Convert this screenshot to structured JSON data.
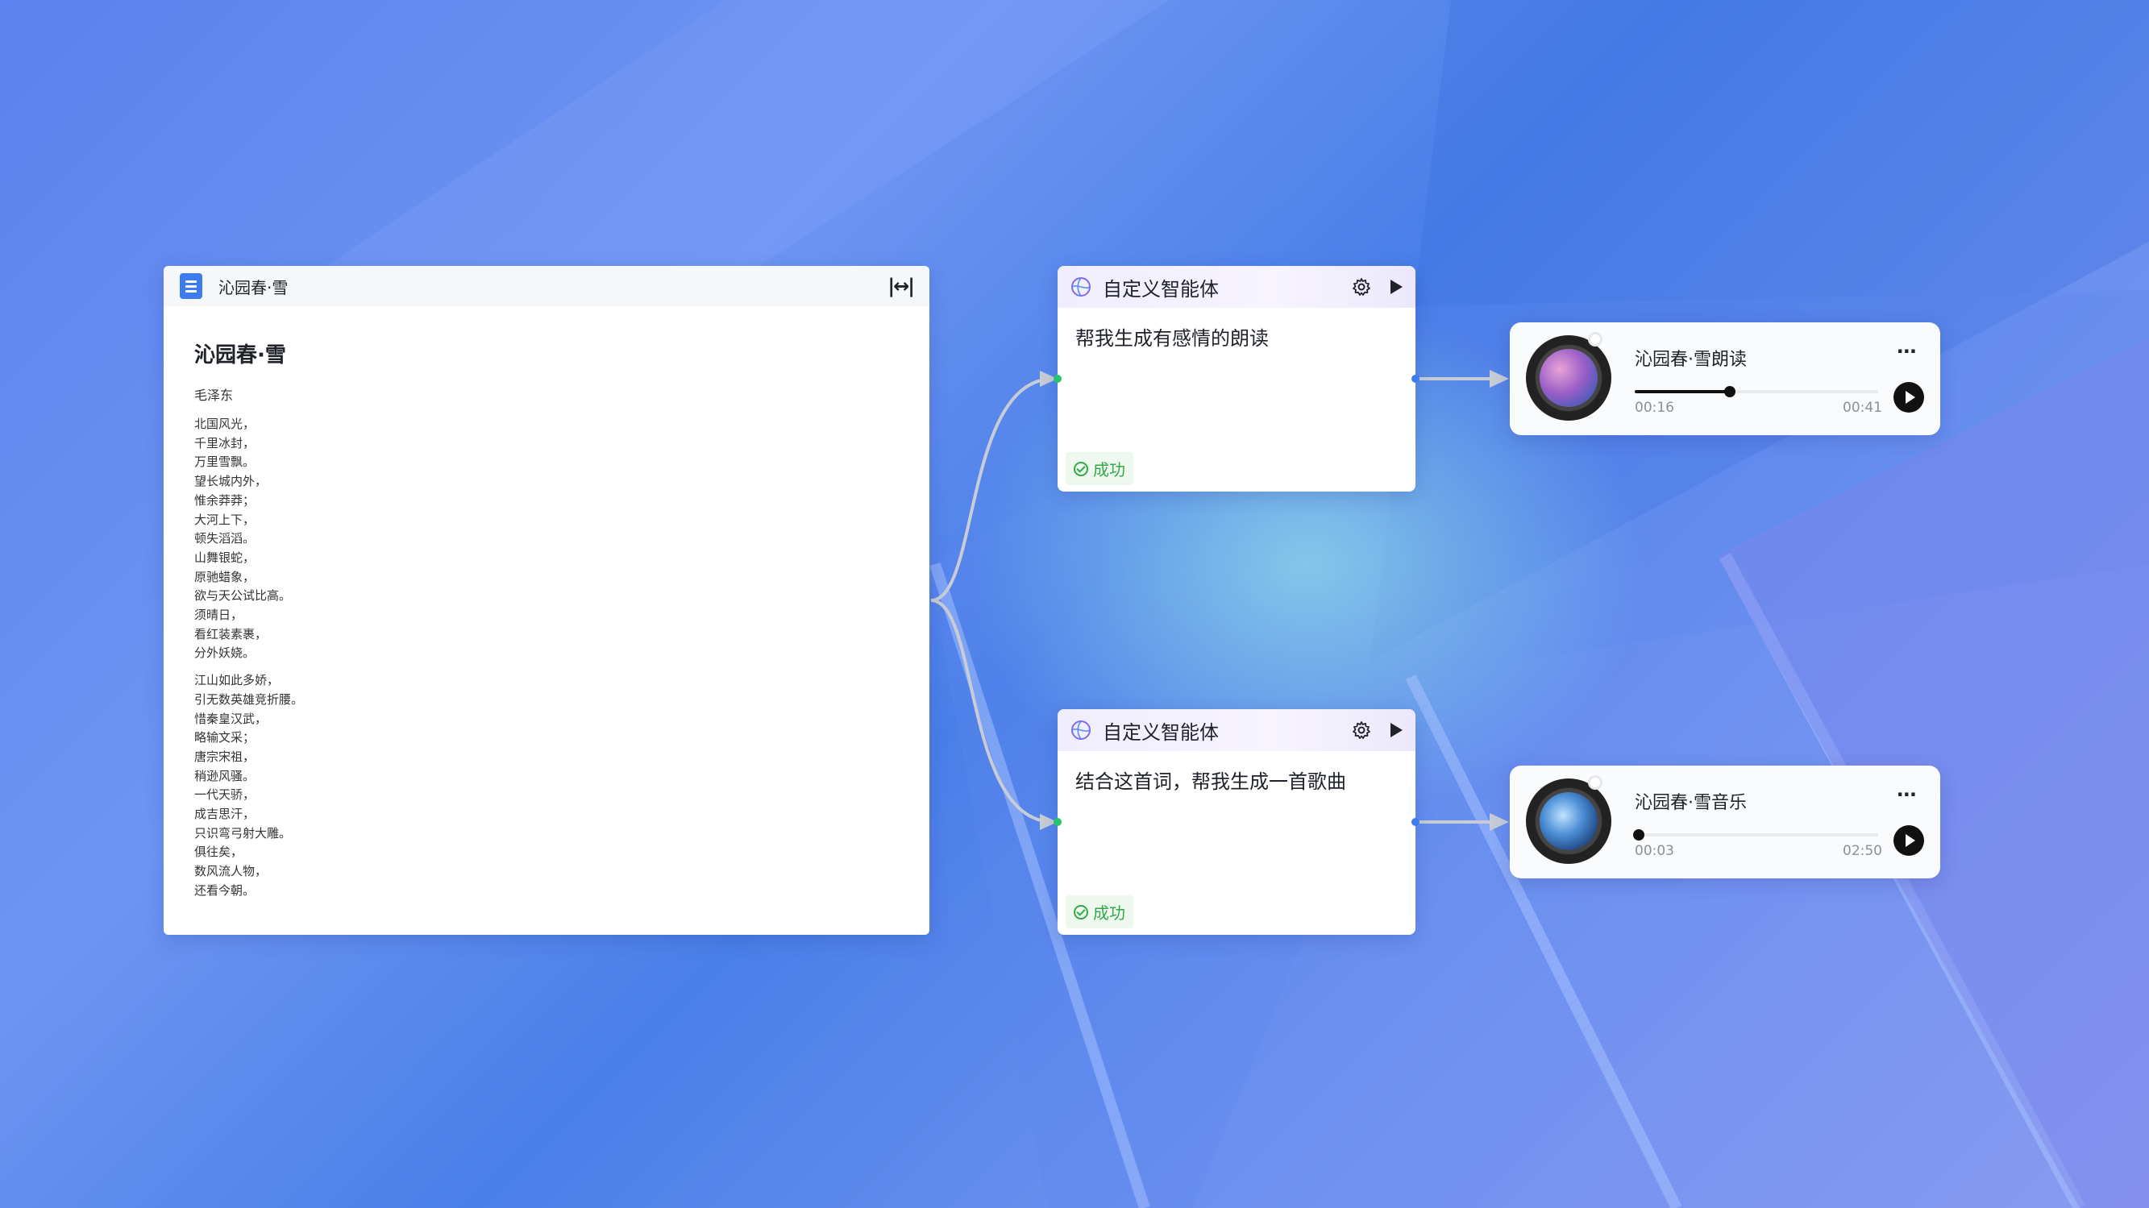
{
  "document": {
    "header_title": "沁园春·雪",
    "expand_icon": "|↔|",
    "title": "沁园春·雪",
    "author": "毛泽东",
    "stanza1": [
      "北国风光，",
      "千里冰封，",
      "万里雪飘。",
      "望长城内外，",
      "惟余莽莽；",
      "大河上下，",
      "顿失滔滔。",
      "山舞银蛇，",
      "原驰蜡象，",
      "欲与天公试比高。",
      "须晴日，",
      "看红装素裹，",
      "分外妖娆。"
    ],
    "stanza2": [
      "江山如此多娇，",
      "引无数英雄竞折腰。",
      "惜秦皇汉武，",
      "略输文采；",
      "唐宗宋祖，",
      "稍逊风骚。",
      "一代天骄，",
      "成吉思汗，",
      "只识弯弓射大雕。",
      "俱往矣，",
      "数风流人物，",
      "还看今朝。"
    ]
  },
  "agents": [
    {
      "title": "自定义智能体",
      "prompt": "帮我生成有感情的朗读",
      "status": "成功"
    },
    {
      "title": "自定义智能体",
      "prompt": "结合这首词，帮我生成一首歌曲",
      "status": "成功"
    }
  ],
  "audios": [
    {
      "title": "沁园春·雪朗读",
      "current": "00:16",
      "total": "00:41",
      "progress": 0.39,
      "more": "···"
    },
    {
      "title": "沁园春·雪音乐",
      "current": "00:03",
      "total": "02:50",
      "progress": 0.018,
      "more": "···"
    }
  ],
  "colors": {
    "accent": "#3d7cf0",
    "success": "#35a94a",
    "port_green": "#27c46c",
    "port_blue": "#3d7cf0"
  }
}
